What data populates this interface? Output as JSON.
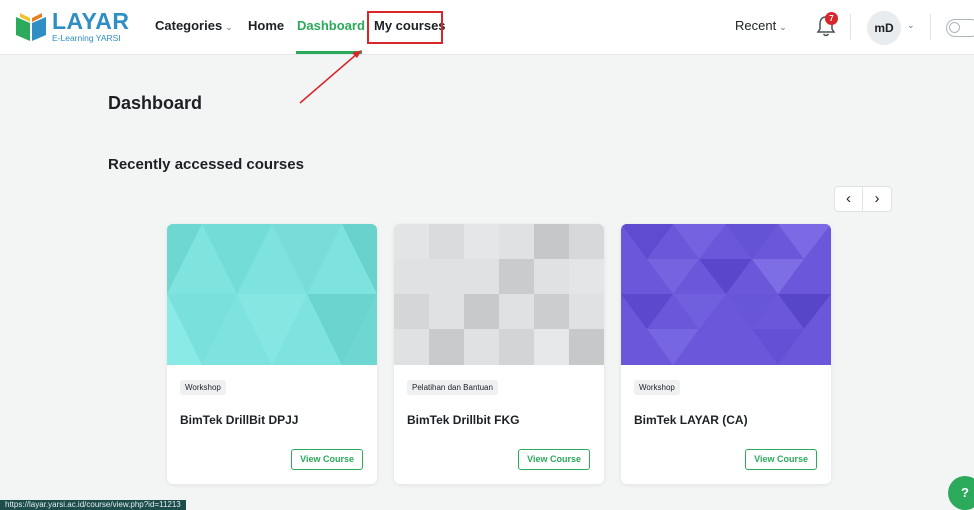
{
  "navbar": {
    "logo": {
      "title": "LAYAR",
      "subtitle": "E-Learning YARSI"
    },
    "links": {
      "categories": "Categories",
      "home": "Home",
      "dashboard": "Dashboard",
      "my_courses": "My courses"
    },
    "recent_label": "Recent",
    "notification_count": "7",
    "avatar_initials": "mD",
    "accent_color": "#2aaa5a",
    "highlight_color": "#d8262a"
  },
  "page": {
    "title": "Dashboard",
    "section_title": "Recently accessed courses"
  },
  "pager": {
    "prev_icon": "‹",
    "next_icon": "›"
  },
  "courses": [
    {
      "category": "Workshop",
      "title": "BimTek DrillBit DPJJ",
      "button": "View Course",
      "pattern": "teal-triangles"
    },
    {
      "category": "Pelatihan dan Bantuan",
      "title": "BimTek Drillbit FKG",
      "button": "View Course",
      "pattern": "grey-squares"
    },
    {
      "category": "Workshop",
      "title": "BimTek LAYAR (CA)",
      "button": "View Course",
      "pattern": "purple-triangles"
    }
  ],
  "status_bar_url": "https://layar.yarsi.ac.id/course/view.php?id=11213",
  "help_icon": "?"
}
